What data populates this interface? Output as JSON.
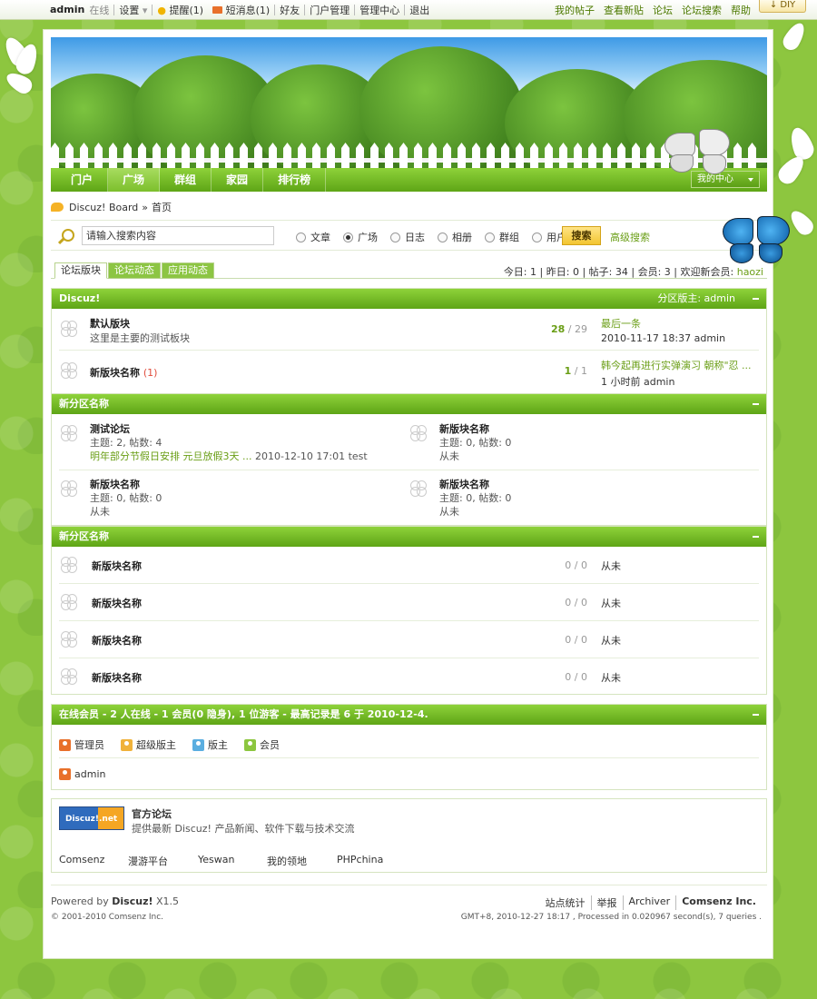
{
  "topbar": {
    "user": "admin",
    "status": "在线",
    "settings": "设置",
    "reminders": "提醒(1)",
    "messages": "短消息(1)",
    "friends": "好友",
    "portal_admin": "门户管理",
    "admin_center": "管理中心",
    "logout": "退出",
    "my_posts": "我的帖子",
    "view_new": "查看新贴",
    "forum": "论坛",
    "forum_search": "论坛搜索",
    "help": "帮助",
    "diy": "DIY"
  },
  "nav": {
    "items": [
      "门户",
      "广场",
      "群组",
      "家园",
      "排行榜"
    ],
    "active_index": 1,
    "my_center": "我的中心"
  },
  "breadcrumb": {
    "site": "Discuz! Board",
    "sep": "»",
    "current": "首页"
  },
  "search": {
    "placeholder": "请输入搜索内容",
    "types": [
      "文章",
      "广场",
      "日志",
      "相册",
      "群组",
      "用户"
    ],
    "selected_index": 1,
    "button": "搜索",
    "advanced": "高级搜索"
  },
  "tabs": [
    "论坛版块",
    "论坛动态",
    "应用动态"
  ],
  "stats": {
    "today_label": "今日:",
    "today": "1",
    "yesterday_label": "昨日:",
    "yesterday": "0",
    "posts_label": "帖子:",
    "posts": "34",
    "members_label": "会员:",
    "members": "3",
    "welcome_label": "欢迎新会员:",
    "new_member": "haozi"
  },
  "section1": {
    "title": "Discuz!",
    "moderator": "分区版主: admin",
    "forums": [
      {
        "name": "默认版块",
        "desc": "这里是主要的测试板块",
        "threads": "28",
        "posts": "29",
        "last_title": "最后一条",
        "last_time": "2010-11-17 18:37 admin",
        "extra": ""
      },
      {
        "name": "新版块名称",
        "desc": "",
        "threads": "1",
        "posts": "1",
        "last_title": "韩今起再进行实弹演习 朝称\"忍 ...",
        "last_time": "1 小时前  admin",
        "extra": "(1)"
      }
    ]
  },
  "section2": {
    "title": "新分区名称",
    "forums": [
      {
        "name": "测试论坛",
        "line1": "主题: 2, 帖数: 4",
        "last_title": "明年部分节假日安排 元旦放假3天 ...",
        "last_time": "2010-12-10 17:01 test"
      },
      {
        "name": "新版块名称",
        "line1": "主题: 0, 帖数: 0",
        "line2": "从未"
      },
      {
        "name": "新版块名称",
        "line1": "主题: 0, 帖数: 0",
        "line2": "从未"
      },
      {
        "name": "新版块名称",
        "line1": "主题: 0, 帖数: 0",
        "line2": "从未"
      }
    ]
  },
  "section3": {
    "title": "新分区名称",
    "forums": [
      {
        "name": "新版块名称",
        "threads": "0",
        "posts": "0",
        "last": "从未"
      },
      {
        "name": "新版块名称",
        "threads": "0",
        "posts": "0",
        "last": "从未"
      },
      {
        "name": "新版块名称",
        "threads": "0",
        "posts": "0",
        "last": "从未"
      },
      {
        "name": "新版块名称",
        "threads": "0",
        "posts": "0",
        "last": "从未"
      }
    ]
  },
  "online": {
    "title": "在线会员 - 2 人在线 - 1 会员(0 隐身), 1 位游客 - 最高记录是 6 于 2010-12-4.",
    "legend": [
      "管理员",
      "超级版主",
      "版主",
      "会员"
    ],
    "legend_colors": [
      "#e8702a",
      "#f0b23a",
      "#5aaee0",
      "#8cc63f"
    ],
    "users": [
      "admin"
    ]
  },
  "links": {
    "logo_text": "Discuz!.net",
    "official_title": "官方论坛",
    "official_desc": "提供最新 Discuz! 产品新闻、软件下载与技术交流",
    "items": [
      "Comsenz",
      "漫游平台",
      "Yeswan",
      "我的领地",
      "PHPchina"
    ]
  },
  "footer": {
    "powered": "Powered by",
    "product": "Discuz!",
    "version": "X1.5",
    "copyright": "© 2001-2010 Comsenz Inc.",
    "links": [
      "站点统计",
      "举报",
      "Archiver",
      "Comsenz Inc."
    ],
    "info": "GMT+8, 2010-12-27 18:17 , Processed in 0.020967 second(s), 7 queries ."
  }
}
